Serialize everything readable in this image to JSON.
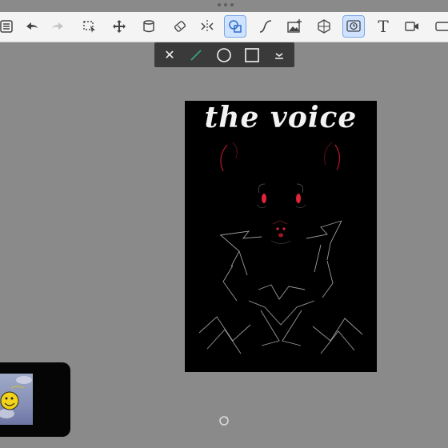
{
  "toolbar": {
    "tools": [
      {
        "name": "layers-icon",
        "glyph": "☰"
      },
      {
        "name": "undo-icon",
        "glyph": "⬅"
      },
      {
        "name": "redo-icon",
        "glyph": "➡"
      },
      {
        "name": "selection-icon",
        "glyph": "⬚"
      },
      {
        "name": "move-icon",
        "glyph": "✥"
      },
      {
        "name": "fill-bucket-icon",
        "glyph": "⛁"
      },
      {
        "name": "eraser-icon",
        "glyph": "✎"
      },
      {
        "name": "symmetry-icon",
        "glyph": "⇹"
      },
      {
        "name": "shape-icon",
        "glyph": "◇"
      },
      {
        "name": "curve-icon",
        "glyph": "∫"
      },
      {
        "name": "insert-image-icon",
        "glyph": "▨"
      },
      {
        "name": "perspective-icon",
        "glyph": "⬡"
      },
      {
        "name": "timelapse-icon",
        "glyph": "◷"
      },
      {
        "name": "text-icon",
        "glyph": "T"
      },
      {
        "name": "video-icon",
        "glyph": "▶"
      },
      {
        "name": "more-icon",
        "glyph": "▭"
      }
    ],
    "active_tools": [
      "shape-icon",
      "timelapse-icon"
    ],
    "disabled_tools": [
      "redo-icon"
    ]
  },
  "shape_bar": {
    "tools": [
      "close-icon",
      "line-icon",
      "circle-icon",
      "rectangle-icon",
      "collapse-icon"
    ],
    "close_glyph": "✕",
    "line_color": "#3aa58a"
  },
  "canvas": {
    "title": "the voice",
    "background": "#000000",
    "title_color": "#f2f2f2",
    "eye_color": "#e0243c"
  },
  "colors": {
    "app_background": "#8a8a8a",
    "toolbar_background": "#f4f4f4",
    "active_tool": "#cfe2ff"
  }
}
